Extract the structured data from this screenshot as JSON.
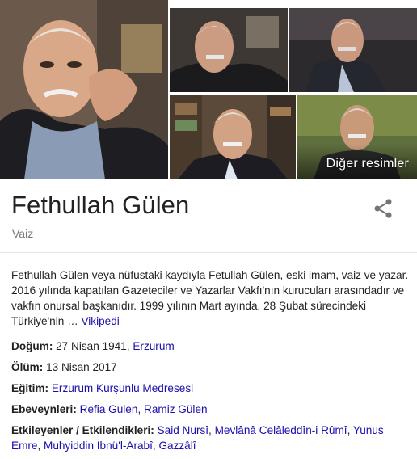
{
  "gallery": {
    "more_label": "Diğer resimler"
  },
  "entity": {
    "name": "Fethullah Gülen",
    "type": "Vaiz"
  },
  "description": {
    "text": "Fethullah Gülen veya nüfustaki kaydıyla Fetullah Gülen, eski imam, vaiz ve yazar. 2016 yılında kapatılan Gazeteciler ve Yazarlar Vakfı'nın kurucuları arasındadır ve vakfın onursal başkanıdır. 1999 yılının Mart ayında, 28 Şubat sürecindeki Türkiye'nin …",
    "source_link": "Vikipedi"
  },
  "facts": {
    "birth": {
      "label": "Doğum:",
      "value": "27 Nisan 1941,",
      "link": "Erzurum"
    },
    "death": {
      "label": "Ölüm:",
      "value": "13 Nisan 2017"
    },
    "education": {
      "label": "Eğitim:",
      "link": "Erzurum Kurşunlu Medresesi"
    },
    "parents": {
      "label": "Ebeveynleri:",
      "link1": "Refia Gulen",
      "sep": ",",
      "link2": "Ramiz Gülen"
    },
    "influences": {
      "label": "Etkileyenler / Etkilendikleri:",
      "items": [
        "Said Nursî",
        "Mevlânâ Celâleddîn-i Rûmî",
        "Yunus Emre",
        "Muhyiddin İbnü'l-Arabî",
        "Gazzâlî"
      ],
      "sep": ","
    }
  },
  "colors": {
    "link": "#1a0dab",
    "title": "#222222",
    "subtitle": "#777777"
  },
  "icons": {
    "share": "share-icon"
  }
}
